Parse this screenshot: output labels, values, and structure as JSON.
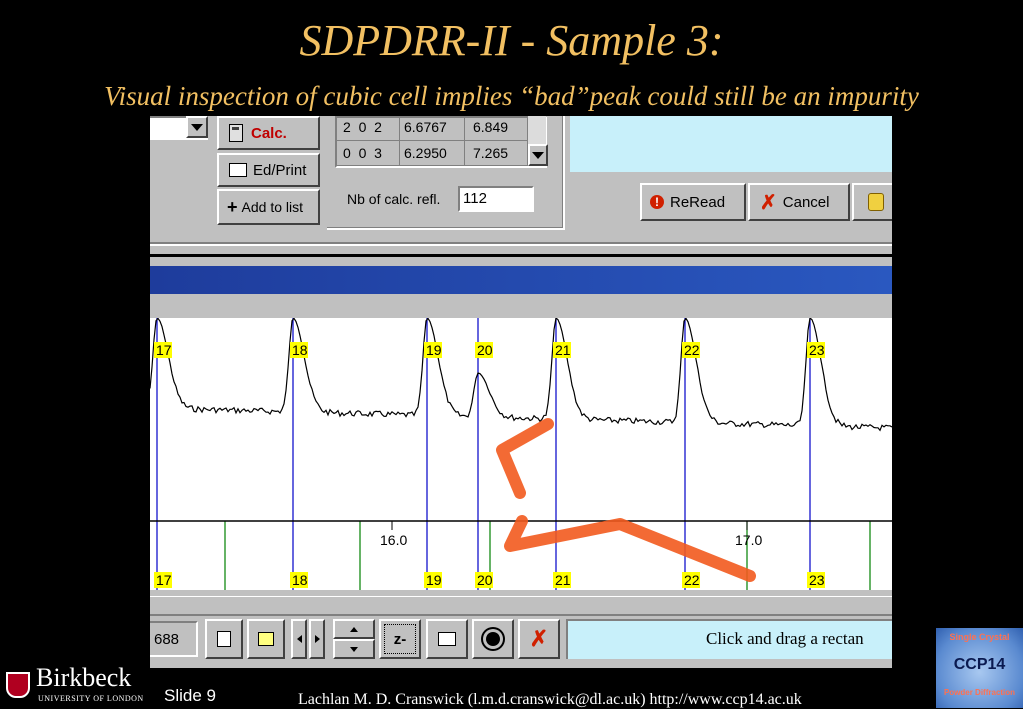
{
  "slide_title": "SDPDRR-II - Sample 3:",
  "slide_subtitle": "Visual inspection of cubic cell implies “bad”peak could still be an impurity",
  "app": {
    "buttons": {
      "calc": "Calc.",
      "ed_print": "Ed/Print",
      "add_to_list": "Add to list",
      "reread": "ReRead",
      "cancel": "Cancel"
    },
    "refl_table": [
      {
        "hkl": "2  0  2",
        "d": "6.6767",
        "two_theta": "6.849"
      },
      {
        "hkl": "0  0  3",
        "d": "6.2950",
        "two_theta": "7.265"
      }
    ],
    "nb_calc_label": "Nb of calc. refl.",
    "nb_calc_value": "112",
    "axis_ticks": [
      "16.0",
      "17.0"
    ],
    "peak_labels": [
      "17",
      "18",
      "19",
      "20",
      "21",
      "22",
      "23"
    ],
    "status_value": "688",
    "zoom_button": "z-",
    "status_hint": "Click and drag a rectan"
  },
  "footer": {
    "logo_text": "Birkbeck",
    "logo_sub": "UNIVERSITY OF LONDON",
    "slide_number": "Slide 9",
    "credit": "Lachlan M. D. Cranswick (l.m.d.cranswick@dl.ac.uk) http://www.ccp14.ac.uk",
    "ccp14_top": "Single Crystal",
    "ccp14_mid": "CCP14",
    "ccp14_bottom": "Powder Diffraction"
  },
  "colors": {
    "title": "#f2c062",
    "label_bg": "#ffff00",
    "marker_blue": "#0000c8",
    "marker_green": "#008000",
    "arrow": "#f25a1e",
    "titlebar": "#1e3c9c"
  }
}
